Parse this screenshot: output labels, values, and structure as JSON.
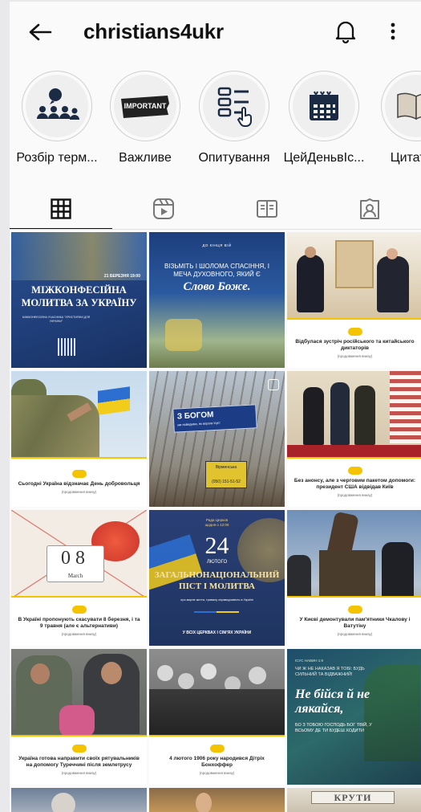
{
  "header": {
    "username": "christians4ukr"
  },
  "highlights": [
    {
      "label": "Розбір терм...",
      "icon": "people-discussion-icon"
    },
    {
      "label": "Важливе",
      "icon": "important-banner-icon",
      "icon_text": "IMPORTANT"
    },
    {
      "label": "Опитування",
      "icon": "poll-list-icon"
    },
    {
      "label": "ЦейДеньвІс...",
      "icon": "calendar-icon"
    },
    {
      "label": "Цитати з",
      "icon": "open-book-icon"
    }
  ],
  "tabs": [
    {
      "name": "grid",
      "icon": "grid-icon",
      "active": true
    },
    {
      "name": "reels",
      "icon": "reels-icon",
      "active": false
    },
    {
      "name": "guides",
      "icon": "guide-book-icon",
      "active": false
    },
    {
      "name": "tagged",
      "icon": "tagged-person-icon",
      "active": false
    }
  ],
  "posts": [
    {
      "title": "МІЖКОНФЕСІЙНА МОЛИТВА ЗА УКРАЇНУ",
      "date": "21 БЕРЕЗНЯ 19:00",
      "sub": "МІЖКОНФЕСІЙНА УЧАСНИКА \"ХРИСТИЯНИ ДЛЯ УКРАЇНИ\""
    },
    {
      "kicker": "ДО КІНЦЯ ВІЙ",
      "title": "Візьміть і шолома спасіння, і меча духовного, який є",
      "highlight": "Слово Боже."
    },
    {
      "caption": "Відбулася зустріч російського та китайського диктаторів",
      "more": "(продовження внизу)"
    },
    {
      "caption": "Сьогодні Україна відзначає День добровольця",
      "more": "(продовження внизу)"
    },
    {
      "sign_title": "З БОГОМ",
      "sign_sub": "ми победимо, як ворога Ісус!",
      "sign2": "Вірменська",
      "phone": "(050) 151-51-52"
    },
    {
      "caption": "Без анонсу, але з черговим пакетом допомоги: президент США відвідав Київ",
      "more": "(продовження внизу)"
    },
    {
      "cal_day": "08",
      "cal_month": "March",
      "caption": "В Україні пропонують скасувати 8 березня, і та 9 травня (але є альтернативи)",
      "more": "(продовження внизу)"
    },
    {
      "top": "Рада Церков",
      "top2": "щодня о 12:00",
      "big": "24",
      "month": "ЛЮТОГО",
      "title": "ЗАГАЛЬНОНАЦІОНАЛЬНИЙ ПІСТ І МОЛИТВА",
      "sub": "про мирне життя, тривалу справедливість в Україні",
      "bottom": "У ВСІХ ЦЕРКВАХ І СІМ'ЯХ УКРАЇНИ"
    },
    {
      "caption": "У Києві демонтували пам'ятники Чкалову і Ватутіну",
      "more": "(продовження внизу)"
    },
    {
      "caption": "Україна готова направити своїх рятувальників на допомогу Туреччині після землетрусу",
      "more": "(продовження внизу)"
    },
    {
      "caption": "4 лютого 1906 року народився Дітріх Бонхоффер",
      "more": "(продовження внизу)"
    },
    {
      "kicker": "ІСУС НАВИН 1:9",
      "lead": "ЧИ Ж НЕ НАКАЗАВ Я ТОБІ: БУДЬ СИЛЬНИЙ ТА ВІДВАЖНИЙ!",
      "title": "Не бійся й не лякайся,",
      "sub": "бо з тобою Господь Бог твій, у всьому де ти будеш ходити"
    },
    {
      "label": ""
    },
    {
      "label": ""
    },
    {
      "sign": "КРУТИ"
    }
  ],
  "colors": {
    "accent_yellow": "#f5c400",
    "navy": "#1f3d78"
  }
}
